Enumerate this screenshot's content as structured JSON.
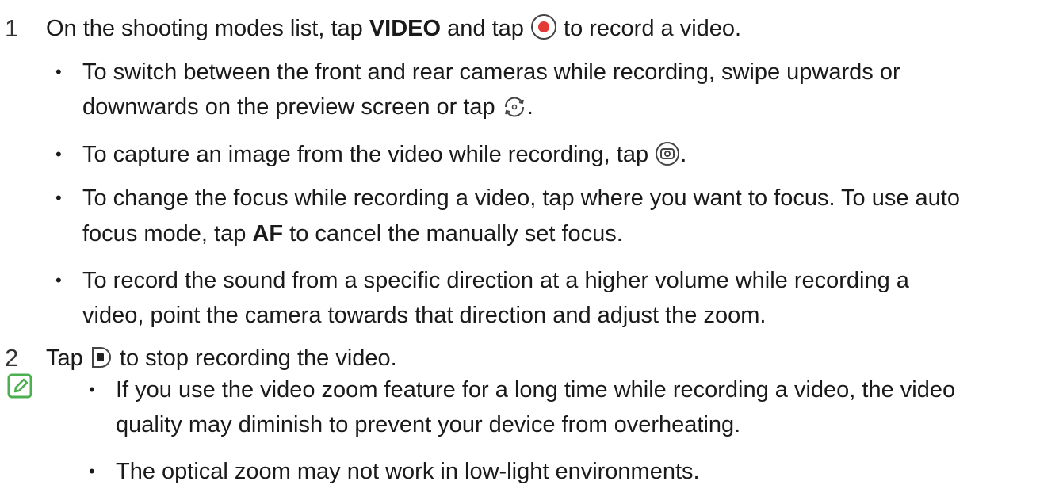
{
  "steps": {
    "s1": {
      "number": "1",
      "pre": "On the shooting modes list, tap ",
      "bold": "VIDEO",
      "mid": " and tap ",
      "post": " to record a video.",
      "record_icon": "record-button-icon"
    },
    "bullets": [
      {
        "line1": "To switch between the front and rear cameras while recording, swipe upwards or",
        "line2": "downwards on the preview screen or tap",
        "line2_end": ".",
        "icon": "switch-camera-icon"
      },
      {
        "line1": "To capture an image from the video while recording, tap",
        "line1_end": ".",
        "icon": "capture-image-icon"
      },
      {
        "line1": "To change the focus while recording a video, tap where you want to focus. To use auto",
        "line2_pre": "focus mode, tap ",
        "line2_bold": "AF",
        "line2_post": " to cancel the manually set focus."
      },
      {
        "line1": "To record the sound from a specific direction at a higher volume while recording a",
        "line2": "video, point the camera towards that direction and adjust the zoom."
      }
    ],
    "s2": {
      "number": "2",
      "pre": "Tap ",
      "post": " to stop recording the video.",
      "stop_icon": "stop-button-icon"
    }
  },
  "notes": {
    "icon": "note-icon",
    "items": [
      {
        "line1": "If you use the video zoom feature for a long time while recording a video, the video",
        "line2": "quality may diminish to prevent your device from overheating."
      },
      {
        "line1": "The optical zoom may not work in low-light environments."
      }
    ]
  },
  "colors": {
    "record_red": "#e53935",
    "note_green": "#4caf50",
    "text": "#1a1a1a"
  }
}
